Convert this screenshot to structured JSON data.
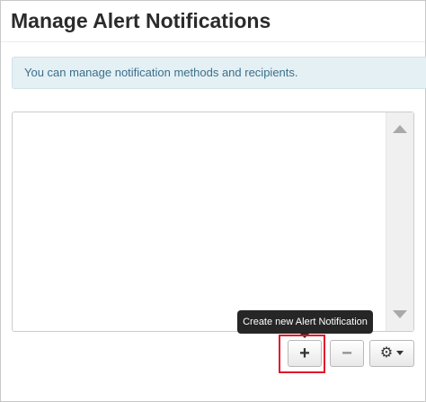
{
  "page": {
    "title": "Manage Alert Notifications"
  },
  "info": {
    "message": "You can manage notification methods and recipients."
  },
  "notification_list": {
    "items": []
  },
  "tooltip": {
    "text": "Create new Alert Notification"
  },
  "toolbar": {
    "add_icon": "+",
    "remove_icon": "−",
    "settings_icon": "⚙"
  },
  "colors": {
    "highlight": "#e0162b",
    "info_background": "#e5f0f4",
    "info_text": "#3a6f8a",
    "tooltip_background": "#262626"
  }
}
